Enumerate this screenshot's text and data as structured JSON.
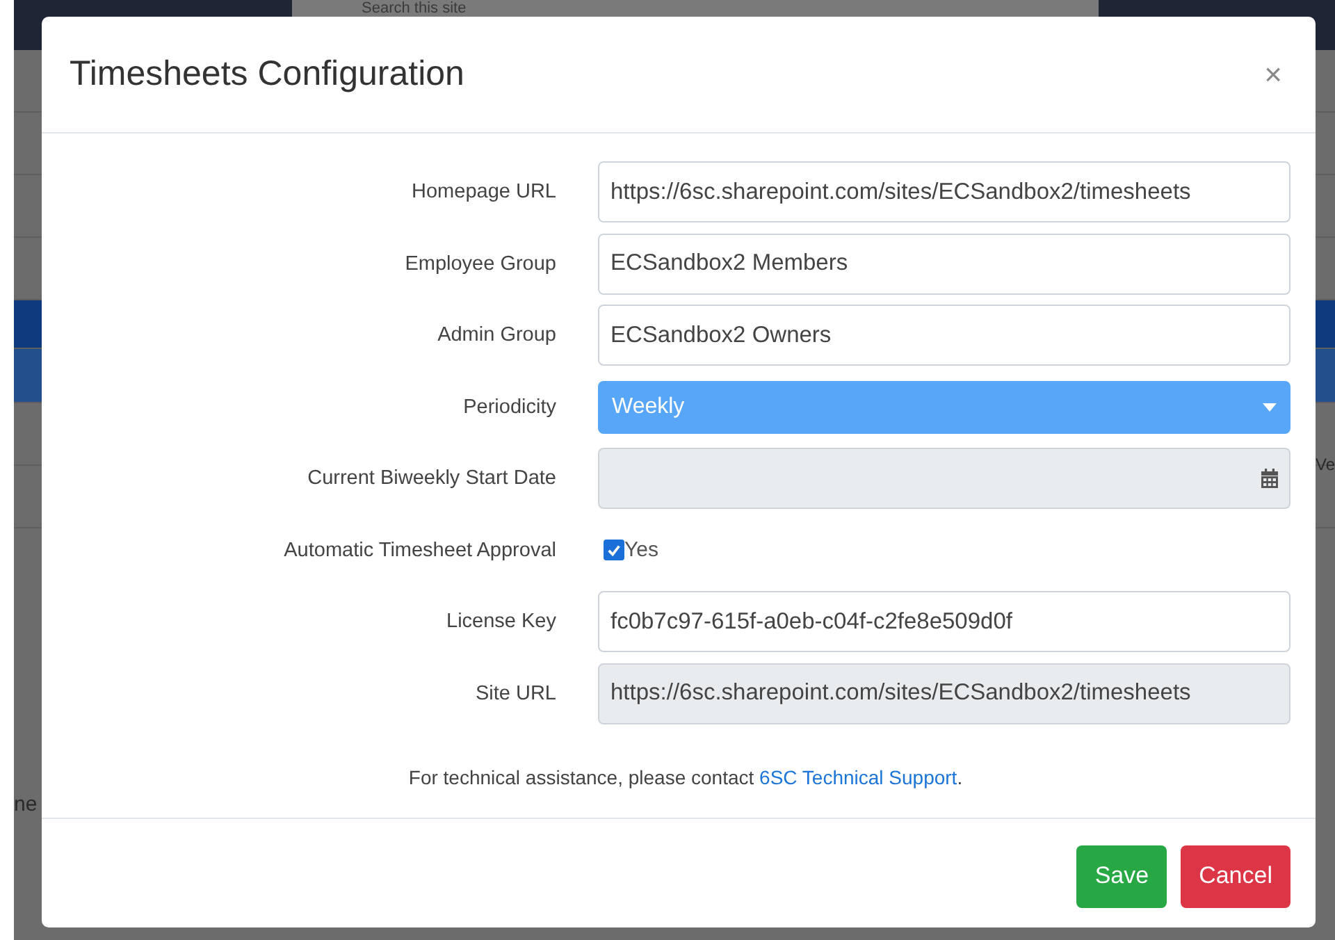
{
  "background": {
    "search": {
      "placeholder": "Search this site"
    },
    "left_fragment": "ne",
    "right_fragment": "Ve"
  },
  "dialog": {
    "title": "Timesheets Configuration",
    "close": "×",
    "fields": [
      {
        "kind": "text",
        "label": "Homepage URL",
        "value": "https://6sc.sharepoint.com/sites/ECSandbox2/timesheets",
        "disabled": false
      },
      {
        "kind": "text",
        "label": "Employee Group",
        "value": "ECSandbox2 Members",
        "disabled": false
      },
      {
        "kind": "text",
        "label": "Admin Group",
        "value": "ECSandbox2 Owners",
        "disabled": false
      },
      {
        "kind": "select",
        "label": "Periodicity",
        "value": "Weekly",
        "disabled": false
      },
      {
        "kind": "date",
        "label": "Current Biweekly Start Date",
        "disabled": true
      },
      {
        "kind": "checkbox",
        "label": "Automatic Timesheet Approval",
        "value": "Yes",
        "checked": true
      },
      {
        "kind": "text",
        "label": "License Key",
        "value": "fc0b7c97-615f-a0eb-c04f-c2fe8e509d0f",
        "disabled": false
      },
      {
        "kind": "text",
        "label": "Site URL",
        "value": "https://6sc.sharepoint.com/sites/ECSandbox2/timesheets",
        "disabled": true
      }
    ],
    "help": {
      "text": "For technical assistance, please contact ",
      "link": "6SC Technical Support",
      "end": "."
    },
    "buttons": [
      {
        "kind": "success",
        "label": "Save"
      },
      {
        "kind": "danger",
        "label": "Cancel"
      }
    ]
  }
}
